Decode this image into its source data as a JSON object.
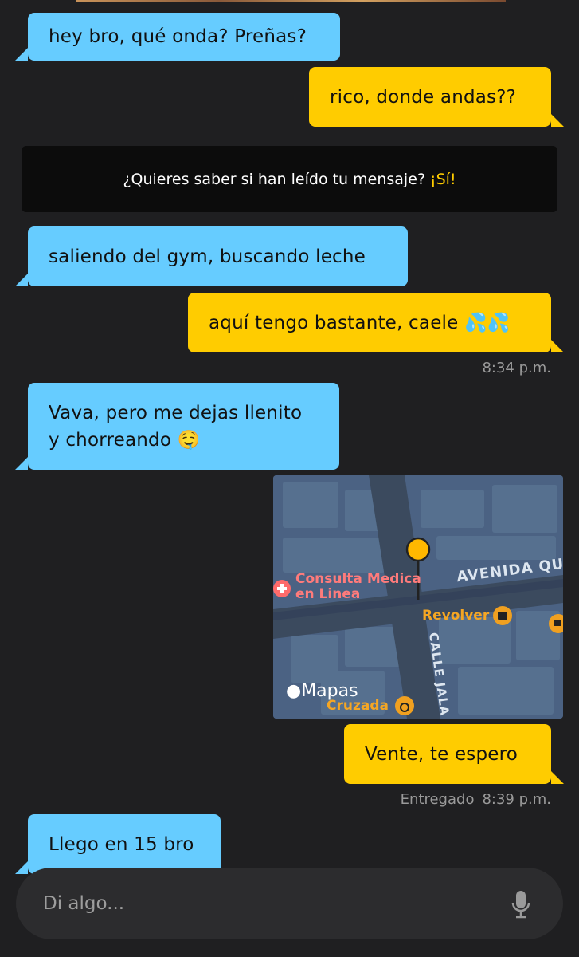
{
  "chat": {
    "messages": [
      {
        "dir": "in",
        "text": "hey bro, qué onda? Preñas?"
      },
      {
        "dir": "out",
        "text": "rico, donde andas??"
      },
      {
        "dir": "in",
        "text": "saliendo del gym, buscando leche"
      },
      {
        "dir": "out",
        "text": "aquí tengo bastante, caele 💦💦"
      },
      {
        "dir": "in",
        "line1": "Vava, pero me dejas llenito",
        "line2": "y  chorreando 🤤"
      },
      {
        "dir": "out",
        "text": "Vente, te espero"
      },
      {
        "dir": "in",
        "text": "Llego en 15 bro"
      }
    ],
    "time_1": "8:34 p.m.",
    "status_2": "Entregado",
    "time_2": "8:39 p.m."
  },
  "read_receipt_notice": {
    "question": "¿Quieres saber si han leído tu mensaje?",
    "cta": "¡Sí!"
  },
  "map_message": {
    "place_1_line1": "Consulta Medica",
    "place_1_line2": "en Linea",
    "street_1": "AVENIDA QU",
    "place_2": "Revolver",
    "street_2": "CALLE JALA",
    "place_3": "Cruzada",
    "watermark": "Mapas"
  },
  "composer": {
    "placeholder": "Di algo...",
    "mic_icon": "microphone-icon"
  },
  "colors": {
    "incoming": "#66ccff",
    "outgoing": "#ffcc00",
    "background": "#1f1f21",
    "map_pin": "#ffb800",
    "map_poi_red": "#ff6b6b"
  }
}
